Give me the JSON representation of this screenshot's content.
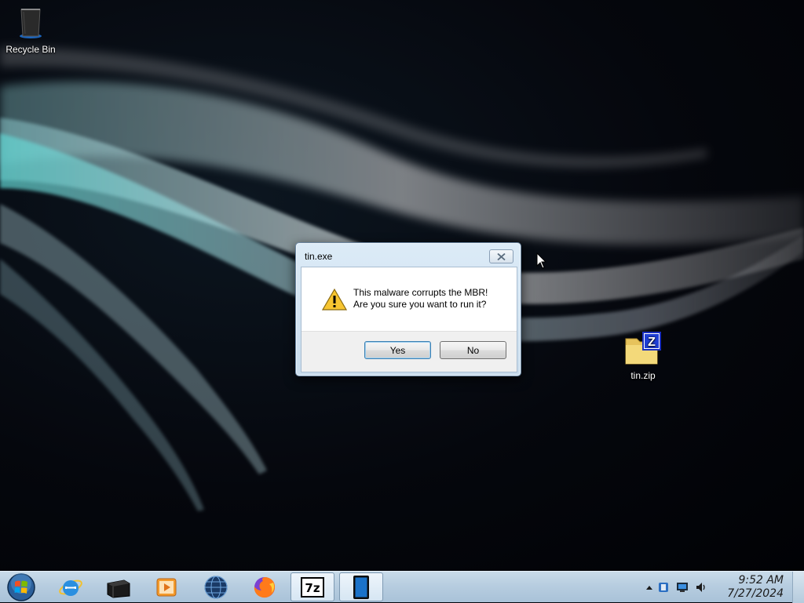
{
  "desktop": {
    "icons": [
      {
        "label": "Recycle Bin",
        "icon": "recycle-bin-icon"
      },
      {
        "label": "tin.zip",
        "icon": "zip-folder-icon"
      }
    ]
  },
  "dialog": {
    "title": "tin.exe",
    "message_line1": "This malware corrupts the MBR!",
    "message_line2": "Are you sure you want to run it?",
    "icon": "warning-icon",
    "yes_label": "Yes",
    "no_label": "No"
  },
  "taskbar": {
    "pinned": [
      {
        "name": "internet-explorer",
        "icon": "internet-explorer-icon"
      },
      {
        "name": "black-box-app",
        "icon": "black-box-icon"
      },
      {
        "name": "media-player",
        "icon": "media-player-icon"
      },
      {
        "name": "globe-app",
        "icon": "globe-icon"
      },
      {
        "name": "firefox",
        "icon": "firefox-icon"
      },
      {
        "name": "7-zip",
        "icon": "7zip-icon",
        "text": "7z"
      },
      {
        "name": "tablet-app",
        "icon": "tablet-icon"
      }
    ],
    "tray": {
      "time": "9:52 AM",
      "date": "7/27/2024"
    }
  },
  "colors": {
    "taskbar": "#b7cde0",
    "dialog_frame": "#dcebf7",
    "default_button_border": "#3c7fb1"
  }
}
